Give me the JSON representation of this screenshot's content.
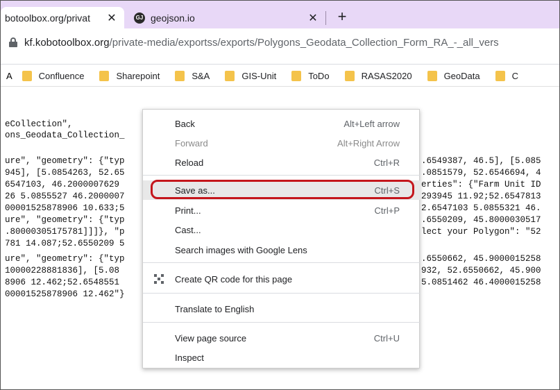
{
  "tabs": [
    {
      "title": "botoolbox.org/privat",
      "close": "✕"
    },
    {
      "title": "geojson.io",
      "favicon": "GJ",
      "close": "✕"
    }
  ],
  "new_tab_icon": "+",
  "address": {
    "host": "kf.kobotoolbox.org",
    "path": "/private-media/exportss/exports/Polygons_Geodata_Collection_Form_RA_-_all_vers"
  },
  "bookmarks": {
    "first_fragment": "A",
    "folders": [
      "Confluence",
      "Sharepoint",
      "S&A",
      "GIS-Unit",
      "ToDo",
      "RASAS2020",
      "GeoData",
      "C"
    ]
  },
  "page_lines_left": [
    "eCollection\",",
    "ons_Geodata_Collection_",
    "",
    "ure\", \"geometry\": {\"typ",
    "945], [5.0854263, 52.65",
    "6547103, 46.2000007629",
    "26 5.0855527 46.2000007",
    "00001525878906 10.633;5",
    "ure\", \"geometry\": {\"typ",
    ".80000305175781]]]}, \"p",
    "781 14.087;52.6550209 5",
    "ure\", \"geometry\": {\"typ",
    "10000228881836], [5.08",
    "8906 12.462;52.6548551",
    "00001525878906 12.462\"}"
  ],
  "page_lines_right": [
    "",
    "",
    "",
    ".6549387, 46.5], [5.085",
    ".0851579, 52.6546694, 4",
    "erties\": {\"Farm Unit ID",
    "293945 11.92;52.6547813",
    "2.6547103 5.0855321 46.",
    ".6550209, 45.8000030517",
    "lect your Polygon\": \"52",
    "",
    ".6550662, 45.9000015258",
    "932, 52.6550662, 45.900",
    "5.0851462 46.4000015258",
    ""
  ],
  "context_menu": {
    "items": [
      {
        "label": "Back",
        "shortcut": "Alt+Left arrow",
        "enabled": true
      },
      {
        "label": "Forward",
        "shortcut": "Alt+Right Arrow",
        "enabled": false
      },
      {
        "label": "Reload",
        "shortcut": "Ctrl+R",
        "enabled": true
      },
      {
        "label": "Save as...",
        "shortcut": "Ctrl+S",
        "enabled": true,
        "highlighted": true
      },
      {
        "label": "Print...",
        "shortcut": "Ctrl+P",
        "enabled": true
      },
      {
        "label": "Cast...",
        "shortcut": "",
        "enabled": true
      },
      {
        "label": "Search images with Google Lens",
        "shortcut": "",
        "enabled": true
      },
      {
        "label": "Create QR code for this page",
        "shortcut": "",
        "enabled": true,
        "icon": "qr-code-icon"
      },
      {
        "label": "Translate to English",
        "shortcut": "",
        "enabled": true
      },
      {
        "label": "View page source",
        "shortcut": "Ctrl+U",
        "enabled": true
      },
      {
        "label": "Inspect",
        "shortcut": "",
        "enabled": true
      }
    ]
  },
  "colors": {
    "tab_strip": "#e8d8f7",
    "folder": "#f4c34b",
    "highlight_box": "#c4161c"
  }
}
